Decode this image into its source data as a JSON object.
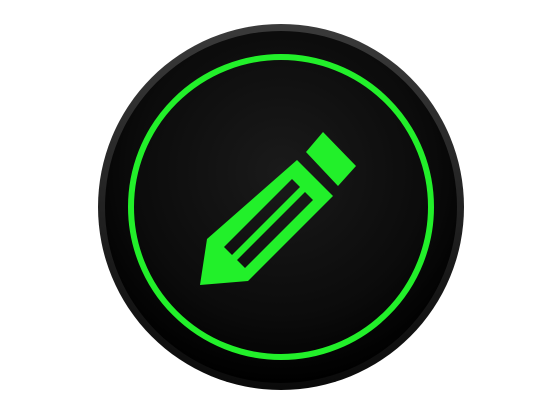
{
  "icon": {
    "name": "pencil-edit-app-icon",
    "glyph": "pencil-icon"
  },
  "colors": {
    "page_background": "#ffffff",
    "disc_outer": "#2a2a2a",
    "disc_inner": "#050505",
    "ring": "#22f02a",
    "pencil": "#22f02a"
  }
}
